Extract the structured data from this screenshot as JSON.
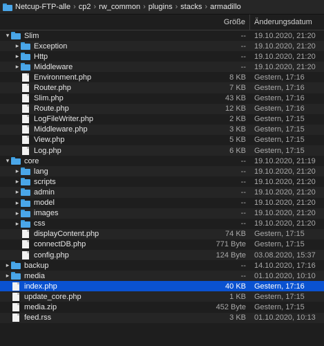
{
  "breadcrumb": [
    "Netcup-FTP-alle",
    "cp2",
    "rw_common",
    "plugins",
    "stacks",
    "armadillo"
  ],
  "columns": {
    "size": "Größe",
    "date": "Änderungsdatum"
  },
  "rows": [
    {
      "name": "Slim",
      "type": "folder",
      "indent": 0,
      "disclosure": "open",
      "size": "--",
      "date": "19.10.2020, 21:20"
    },
    {
      "name": "Exception",
      "type": "folder",
      "indent": 1,
      "disclosure": "closed",
      "size": "--",
      "date": "19.10.2020, 21:20"
    },
    {
      "name": "Http",
      "type": "folder",
      "indent": 1,
      "disclosure": "closed",
      "size": "--",
      "date": "19.10.2020, 21:20"
    },
    {
      "name": "Middleware",
      "type": "folder",
      "indent": 1,
      "disclosure": "closed",
      "size": "--",
      "date": "19.10.2020, 21:20"
    },
    {
      "name": "Environment.php",
      "type": "file",
      "indent": 1,
      "disclosure": "",
      "size": "8 KB",
      "date": "Gestern, 17:16"
    },
    {
      "name": "Router.php",
      "type": "file",
      "indent": 1,
      "disclosure": "",
      "size": "7 KB",
      "date": "Gestern, 17:16"
    },
    {
      "name": "Slim.php",
      "type": "file",
      "indent": 1,
      "disclosure": "",
      "size": "43 KB",
      "date": "Gestern, 17:16"
    },
    {
      "name": "Route.php",
      "type": "file",
      "indent": 1,
      "disclosure": "",
      "size": "12 KB",
      "date": "Gestern, 17:16"
    },
    {
      "name": "LogFileWriter.php",
      "type": "file",
      "indent": 1,
      "disclosure": "",
      "size": "2 KB",
      "date": "Gestern, 17:15"
    },
    {
      "name": "Middleware.php",
      "type": "file",
      "indent": 1,
      "disclosure": "",
      "size": "3 KB",
      "date": "Gestern, 17:15"
    },
    {
      "name": "View.php",
      "type": "file",
      "indent": 1,
      "disclosure": "",
      "size": "5 KB",
      "date": "Gestern, 17:15"
    },
    {
      "name": "Log.php",
      "type": "file",
      "indent": 1,
      "disclosure": "",
      "size": "6 KB",
      "date": "Gestern, 17:15"
    },
    {
      "name": "core",
      "type": "folder",
      "indent": 0,
      "disclosure": "open",
      "size": "--",
      "date": "19.10.2020, 21:19"
    },
    {
      "name": "lang",
      "type": "folder",
      "indent": 1,
      "disclosure": "closed",
      "size": "--",
      "date": "19.10.2020, 21:20"
    },
    {
      "name": "scripts",
      "type": "folder",
      "indent": 1,
      "disclosure": "closed",
      "size": "--",
      "date": "19.10.2020, 21:20"
    },
    {
      "name": "admin",
      "type": "folder",
      "indent": 1,
      "disclosure": "closed",
      "size": "--",
      "date": "19.10.2020, 21:20"
    },
    {
      "name": "model",
      "type": "folder",
      "indent": 1,
      "disclosure": "closed",
      "size": "--",
      "date": "19.10.2020, 21:20"
    },
    {
      "name": "images",
      "type": "folder",
      "indent": 1,
      "disclosure": "closed",
      "size": "--",
      "date": "19.10.2020, 21:20"
    },
    {
      "name": "css",
      "type": "folder",
      "indent": 1,
      "disclosure": "closed",
      "size": "--",
      "date": "19.10.2020, 21:20"
    },
    {
      "name": "displayContent.php",
      "type": "file",
      "indent": 1,
      "disclosure": "",
      "size": "74 KB",
      "date": "Gestern, 17:15"
    },
    {
      "name": "connectDB.php",
      "type": "file",
      "indent": 1,
      "disclosure": "",
      "size": "771 Byte",
      "date": "Gestern, 17:15"
    },
    {
      "name": "config.php",
      "type": "file",
      "indent": 1,
      "disclosure": "",
      "size": "124 Byte",
      "date": "03.08.2020, 15:37"
    },
    {
      "name": "backup",
      "type": "folder",
      "indent": 0,
      "disclosure": "closed",
      "size": "--",
      "date": "14.10.2020, 17:16"
    },
    {
      "name": "media",
      "type": "folder",
      "indent": 0,
      "disclosure": "closed",
      "size": "--",
      "date": "01.10.2020, 10:10"
    },
    {
      "name": "index.php",
      "type": "file",
      "indent": 0,
      "disclosure": "",
      "size": "40 KB",
      "date": "Gestern, 17:16",
      "selected": true
    },
    {
      "name": "update_core.php",
      "type": "file",
      "indent": 0,
      "disclosure": "",
      "size": "1 KB",
      "date": "Gestern, 17:15"
    },
    {
      "name": "media.zip",
      "type": "file",
      "indent": 0,
      "disclosure": "",
      "size": "452 Byte",
      "date": "Gestern, 17:15"
    },
    {
      "name": "feed.rss",
      "type": "file",
      "indent": 0,
      "disclosure": "",
      "size": "3 KB",
      "date": "01.10.2020, 10:13"
    }
  ]
}
